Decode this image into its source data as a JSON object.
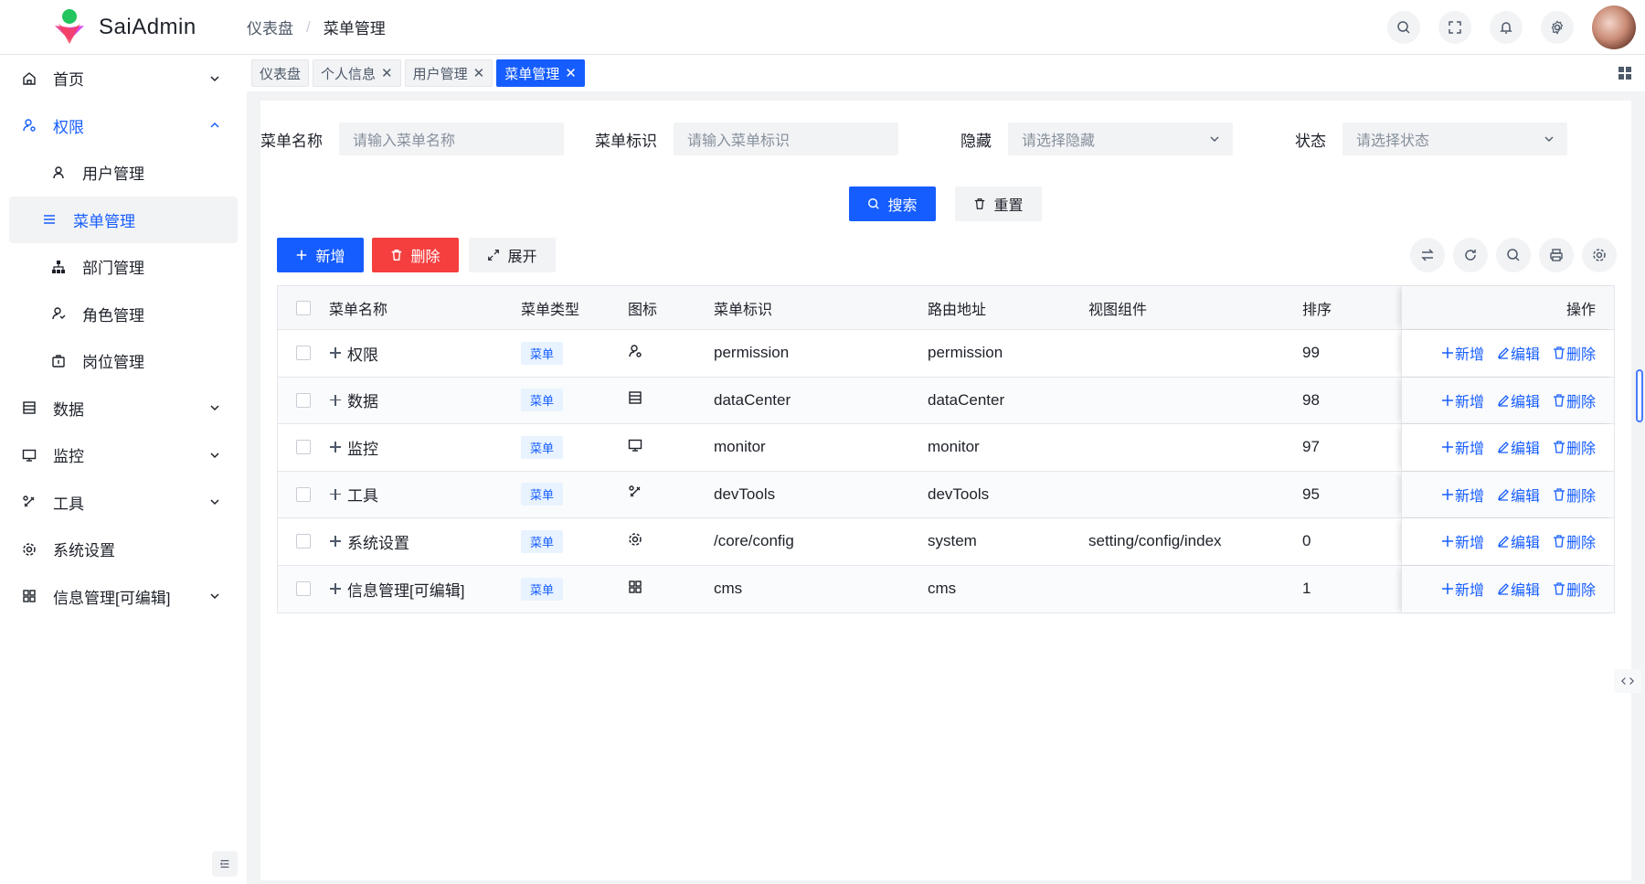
{
  "app": {
    "name": "SaiAdmin"
  },
  "breadcrumb": {
    "items": [
      "仪表盘",
      "菜单管理"
    ],
    "separator": "/"
  },
  "header": {
    "icons": [
      "search-icon",
      "fullscreen-icon",
      "bell-icon",
      "gear-icon"
    ]
  },
  "sidebar": {
    "items": [
      {
        "label": "首页",
        "icon": "home-icon",
        "expandable": true
      },
      {
        "label": "权限",
        "icon": "user-key-icon",
        "expandable": true,
        "expanded": true,
        "children": [
          {
            "label": "用户管理",
            "icon": "user-icon"
          },
          {
            "label": "菜单管理",
            "icon": "menu-icon",
            "active": true
          },
          {
            "label": "部门管理",
            "icon": "org-icon"
          },
          {
            "label": "角色管理",
            "icon": "role-icon"
          },
          {
            "label": "岗位管理",
            "icon": "post-icon"
          }
        ]
      },
      {
        "label": "数据",
        "icon": "list-icon",
        "expandable": true
      },
      {
        "label": "监控",
        "icon": "monitor-icon",
        "expandable": true
      },
      {
        "label": "工具",
        "icon": "tools-icon",
        "expandable": true
      },
      {
        "label": "系统设置",
        "icon": "gear-icon",
        "expandable": false
      },
      {
        "label": "信息管理[可编辑]",
        "icon": "apps-icon",
        "expandable": true
      }
    ]
  },
  "tabs": [
    {
      "label": "仪表盘",
      "closable": false
    },
    {
      "label": "个人信息",
      "closable": true
    },
    {
      "label": "用户管理",
      "closable": true
    },
    {
      "label": "菜单管理",
      "closable": true,
      "active": true
    }
  ],
  "search": {
    "fields": [
      {
        "label": "菜单名称",
        "placeholder": "请输入菜单名称",
        "type": "input"
      },
      {
        "label": "菜单标识",
        "placeholder": "请输入菜单标识",
        "type": "input"
      },
      {
        "label": "隐藏",
        "placeholder": "请选择隐藏",
        "type": "select"
      },
      {
        "label": "状态",
        "placeholder": "请选择状态",
        "type": "select"
      }
    ],
    "search_label": "搜索",
    "reset_label": "重置"
  },
  "toolbar": {
    "add_label": "新增",
    "delete_label": "删除",
    "expand_label": "展开"
  },
  "table": {
    "columns": [
      "菜单名称",
      "菜单类型",
      "图标",
      "菜单标识",
      "路由地址",
      "视图组件",
      "排序",
      "操作"
    ],
    "rows": [
      {
        "name": "权限",
        "type": "菜单",
        "icon": "user-key-icon",
        "code": "permission",
        "path": "permission",
        "component": "",
        "sort": "99"
      },
      {
        "name": "数据",
        "type": "菜单",
        "icon": "list-icon",
        "code": "dataCenter",
        "path": "dataCenter",
        "component": "",
        "sort": "98"
      },
      {
        "name": "监控",
        "type": "菜单",
        "icon": "monitor-icon",
        "code": "monitor",
        "path": "monitor",
        "component": "",
        "sort": "97"
      },
      {
        "name": "工具",
        "type": "菜单",
        "icon": "tools-icon",
        "code": "devTools",
        "path": "devTools",
        "component": "",
        "sort": "95"
      },
      {
        "name": "系统设置",
        "type": "菜单",
        "icon": "gear-icon",
        "code": "/core/config",
        "path": "system",
        "component": "setting/config/index",
        "sort": "0"
      },
      {
        "name": "信息管理[可编辑]",
        "type": "菜单",
        "icon": "apps-icon",
        "code": "cms",
        "path": "cms",
        "component": "",
        "sort": "1"
      }
    ],
    "row_actions": {
      "add": "新增",
      "edit": "编辑",
      "delete": "删除"
    }
  },
  "colors": {
    "primary": "#165dff",
    "danger": "#f53f3f",
    "background": "#f2f3f5"
  }
}
